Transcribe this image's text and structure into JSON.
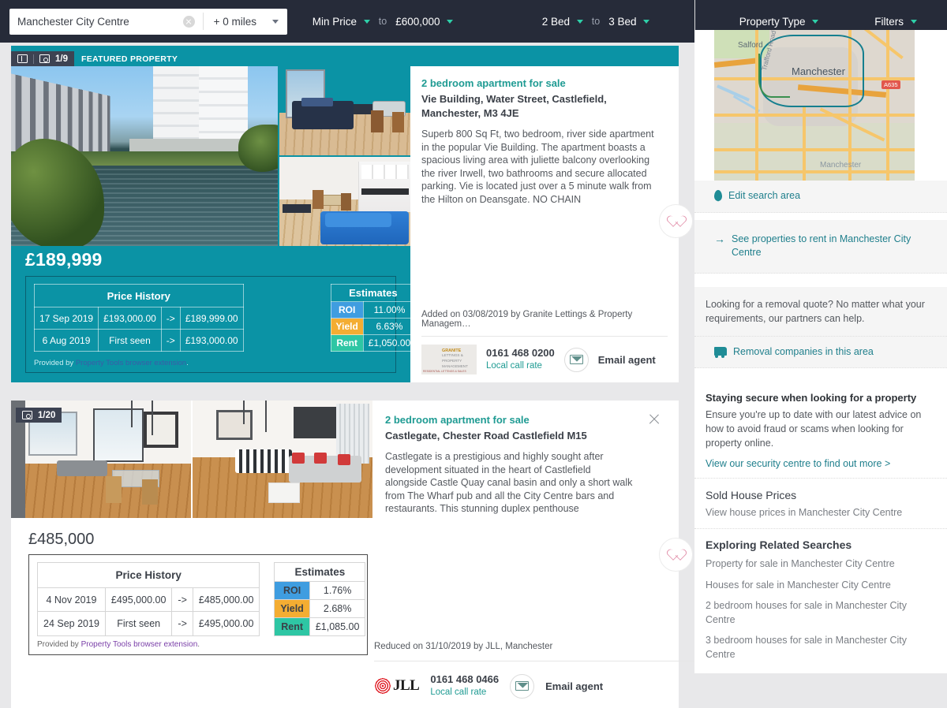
{
  "topbar": {
    "search": {
      "value": "Manchester City Centre",
      "placeholder": "Search location",
      "clear_icon": "clear-circle-icon"
    },
    "radius": {
      "label": "+ 0 miles",
      "caret_icon": "chevron-down-icon"
    },
    "price": {
      "min_label": "Min Price",
      "to": "to",
      "max_label": "£600,000"
    },
    "beds": {
      "min_label": "2 Bed",
      "to": "to",
      "max_label": "3 Bed"
    },
    "property_type_label": "Property Type",
    "filters_label": "Filters",
    "accent": "#2ecfa8",
    "background": "#262b39"
  },
  "listings": [
    {
      "badge": {
        "floorplan_icon": "floorplan-icon",
        "camera_icon": "camera-icon",
        "photo_count": "1/9",
        "featured_label": "FEATURED PROPERTY"
      },
      "title": "2 bedroom apartment for sale",
      "address": "Vie Building, Water Street, Castlefield, Manchester, M3 4JE",
      "description": "Superb 800 Sq Ft, two bedroom, river side apartment in the popular Vie Building. The apartment boasts a spacious living area with juliette balcony overlooking the river Irwell, two bathrooms and secure allocated parking. Vie is located just over a 5 minute walk from the Hilton on Deansgate. NO CHAIN",
      "price": "£189,999",
      "price_history": {
        "header": "Price History",
        "rows": [
          {
            "date": "17 Sep 2019",
            "from": "£193,000.00",
            "arrow": "->",
            "to": "£189,999.00"
          },
          {
            "date": "6 Aug 2019",
            "from": "First seen",
            "arrow": "->",
            "to": "£193,000.00"
          }
        ]
      },
      "estimates": {
        "header": "Estimates",
        "roi_label": "ROI",
        "roi_value": "11.00%",
        "yield_label": "Yield",
        "yield_value": "6.63%",
        "rent_label": "Rent",
        "rent_value": "£1,050.00"
      },
      "credit_prefix": "Provided by ",
      "credit_link": "Property Tools browser extension",
      "credit_suffix": ".",
      "added_line": "Added on 03/08/2019 by Granite Lettings & Property Managem…",
      "agent": {
        "logo_line1": "GRANITE",
        "logo_line2": "LETTINGS & PROPERTY MANAGEMENT",
        "logo_line3": "RESIDENTIAL LETTINGS & SALES",
        "phone": "0161 468 0200",
        "call_rate": "Local call rate",
        "email_label": "Email agent",
        "email_icon": "envelope-icon"
      },
      "save_icon": "heart-icon"
    },
    {
      "badge": {
        "camera_icon": "camera-icon",
        "photo_count": "1/20"
      },
      "title": "2 bedroom apartment for sale",
      "address": "Castlegate, Chester Road Castlefield M15",
      "description": "Castlegate is a prestigious and highly sought after development situated in the heart of Castlefield alongside Castle Quay canal basin and only a short walk from The Wharf pub and all the City Centre bars and restaurants. This stunning duplex penthouse",
      "price": "£485,000",
      "close_icon": "close-icon",
      "price_history": {
        "header": "Price History",
        "rows": [
          {
            "date": "4 Nov 2019",
            "from": "£495,000.00",
            "arrow": "->",
            "to": "£485,000.00"
          },
          {
            "date": "24 Sep 2019",
            "from": "First seen",
            "arrow": "->",
            "to": "£495,000.00"
          }
        ]
      },
      "estimates": {
        "header": "Estimates",
        "roi_label": "ROI",
        "roi_value": "1.76%",
        "yield_label": "Yield",
        "yield_value": "2.68%",
        "rent_label": "Rent",
        "rent_value": "£1,085.00"
      },
      "credit_prefix": "Provided by ",
      "credit_link": "Property Tools browser extension",
      "credit_suffix": ".",
      "added_line": "Reduced on 31/10/2019 by JLL, Manchester",
      "agent": {
        "logo_text": "JLL",
        "phone": "0161 468 0466",
        "call_rate": "Local call rate",
        "email_label": "Email agent",
        "email_icon": "envelope-icon"
      },
      "save_icon": "heart-icon"
    }
  ],
  "sidebar": {
    "map": {
      "labels": [
        "Salford",
        "Manchester",
        "Trafford Road",
        "Manchester"
      ],
      "road_badge": "A635",
      "area_color": "#157f8f"
    },
    "edit_search_area": {
      "label": "Edit search area",
      "icon": "map-pin-icon"
    },
    "rent_link": {
      "label": "See properties to rent in Manchester City Centre",
      "icon": "arrow-right-icon"
    },
    "removal": {
      "text": "Looking for a removal quote? No matter what your requirements, our partners can help.",
      "link": "Removal companies in this area",
      "icon": "truck-icon"
    },
    "secure": {
      "heading": "Staying secure when looking for a property",
      "body": "Ensure you're up to date with our latest advice on how to avoid fraud or scams when looking for property online.",
      "link": "View our security centre to find out more >"
    },
    "sold_prices": {
      "heading": "Sold House Prices",
      "body": "View house prices in Manchester City Centre"
    },
    "related": {
      "heading": "Exploring Related Searches",
      "items": [
        "Property for sale in Manchester City Centre",
        "Houses for sale in Manchester City Centre",
        "2 bedroom houses for sale in Manchester City Centre",
        "3 bedroom houses for sale in Manchester City Centre"
      ]
    }
  }
}
